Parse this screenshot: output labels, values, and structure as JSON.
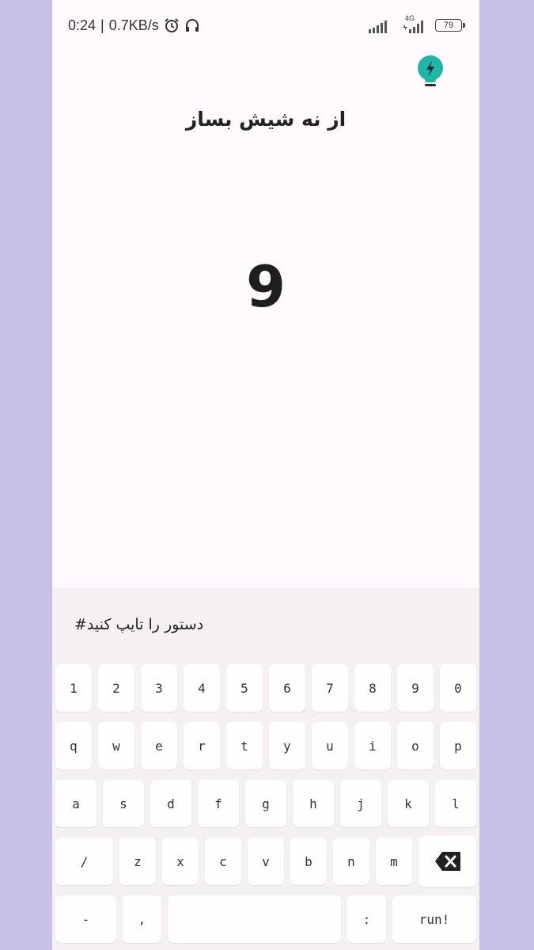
{
  "status": {
    "time": "0:24",
    "speed": "0.7KB/s",
    "network": "4G",
    "battery": "79"
  },
  "icons": {
    "hint": "lightbulb-bolt-icon",
    "alarm": "alarm-clock-icon",
    "headphones": "headphones-icon",
    "signal": "cell-signal-icon",
    "battery": "battery-icon",
    "backspace": "backspace-icon"
  },
  "colors": {
    "accent": "#1fb6a8",
    "background": "#c8c0e6",
    "screen": "#fffafd",
    "keyboard": "#f5f1f3"
  },
  "puzzle": {
    "title": "از نه شیش بساز",
    "number": "9"
  },
  "command": {
    "placeholder": "دستور را تایپ کنید#",
    "value": ""
  },
  "keyboard": {
    "row1": [
      "1",
      "2",
      "3",
      "4",
      "5",
      "6",
      "7",
      "8",
      "9",
      "0"
    ],
    "row2": [
      "q",
      "w",
      "e",
      "r",
      "t",
      "y",
      "u",
      "i",
      "o",
      "p"
    ],
    "row3": [
      "a",
      "s",
      "d",
      "f",
      "g",
      "h",
      "j",
      "k",
      "l"
    ],
    "row4": [
      "/",
      "z",
      "x",
      "c",
      "v",
      "b",
      "n",
      "m"
    ],
    "row5": [
      "-",
      ",",
      "",
      ":",
      "run!"
    ]
  }
}
